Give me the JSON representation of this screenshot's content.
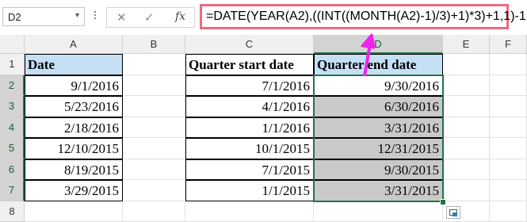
{
  "formula_bar": {
    "name_box": "D2",
    "dropdown_glyph": "▾",
    "cancel_glyph": "✕",
    "enter_glyph": "✓",
    "fx_label": "fx",
    "formula": "=DATE(YEAR(A2),((INT((MONTH(A2)-1)/3)+1)*3)+1,1)-1"
  },
  "columns": [
    "A",
    "B",
    "C",
    "D",
    "E",
    "F"
  ],
  "rows": [
    "1",
    "2",
    "3",
    "4",
    "5",
    "6",
    "7",
    "8"
  ],
  "cells": {
    "A1": "Date",
    "C1": "Quarter start date",
    "D1": "Quarter end date",
    "A": [
      "9/1/2016",
      "5/23/2016",
      "2/18/2016",
      "12/10/2015",
      "8/19/2015",
      "3/29/2015"
    ],
    "C": [
      "7/1/2016",
      "4/1/2016",
      "1/1/2016",
      "10/1/2015",
      "7/1/2015",
      "1/1/2015"
    ],
    "D": [
      "9/30/2016",
      "6/30/2016",
      "3/31/2016",
      "12/31/2015",
      "9/30/2015",
      "3/31/2015"
    ]
  },
  "colors": {
    "accent_green": "#217346",
    "highlight_pink": "#ef6b7d",
    "arrow_magenta": "#ee22ee",
    "header_blue": "#c5e0f5",
    "fill_gray": "#c9c9c9"
  }
}
